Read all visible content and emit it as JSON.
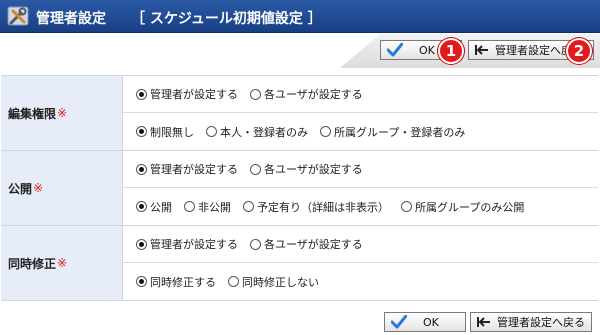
{
  "header": {
    "title": "管理者設定",
    "subtitle": "［ スケジュール初期値設定 ］"
  },
  "toolbar": {
    "ok_label": "OK",
    "back_label": "管理者設定へ戻る",
    "badge_ok": "1",
    "badge_back": "2"
  },
  "form": {
    "groups": [
      {
        "label": "編集権限",
        "required_mark": "※",
        "rows": [
          {
            "options": [
              {
                "label": "管理者が設定する",
                "checked": true
              },
              {
                "label": "各ユーザが設定する",
                "checked": false
              }
            ]
          },
          {
            "options": [
              {
                "label": "制限無し",
                "checked": true
              },
              {
                "label": "本人・登録者のみ",
                "checked": false
              },
              {
                "label": "所属グループ・登録者のみ",
                "checked": false
              }
            ]
          }
        ]
      },
      {
        "label": "公開",
        "required_mark": "※",
        "rows": [
          {
            "options": [
              {
                "label": "管理者が設定する",
                "checked": true
              },
              {
                "label": "各ユーザが設定する",
                "checked": false
              }
            ]
          },
          {
            "options": [
              {
                "label": "公開",
                "checked": true
              },
              {
                "label": "非公開",
                "checked": false
              },
              {
                "label": "予定有り（詳細は非表示）",
                "checked": false
              },
              {
                "label": "所属グループのみ公開",
                "checked": false
              }
            ]
          }
        ]
      },
      {
        "label": "同時修正",
        "required_mark": "※",
        "rows": [
          {
            "options": [
              {
                "label": "管理者が設定する",
                "checked": true
              },
              {
                "label": "各ユーザが設定する",
                "checked": false
              }
            ]
          },
          {
            "options": [
              {
                "label": "同時修正する",
                "checked": true
              },
              {
                "label": "同時修正しない",
                "checked": false
              }
            ]
          }
        ]
      }
    ]
  },
  "colors": {
    "title_bar": "#1f4a93",
    "label_bg": "#e6ecf8",
    "required": "#e41f1f",
    "badge": "#e11b1b"
  }
}
